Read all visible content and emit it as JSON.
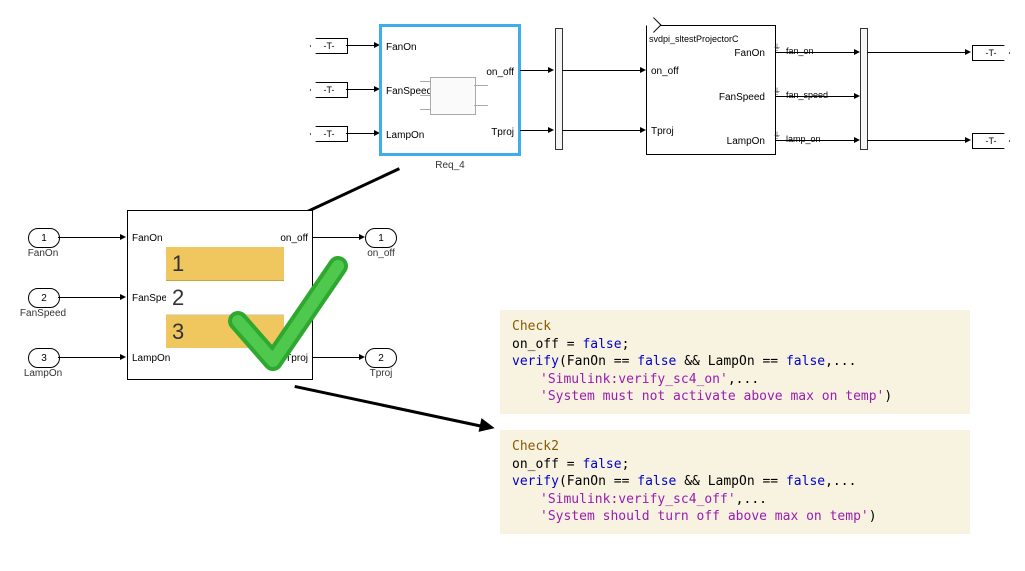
{
  "top": {
    "block1": {
      "name": "Req_4",
      "inports": [
        "FanOn",
        "FanSpeed",
        "LampOn"
      ],
      "outports": [
        "on_off",
        "Tproj"
      ]
    },
    "from_tags": [
      "-T-",
      "-T-",
      "-T-"
    ],
    "goto_tags": [
      "-T-",
      "-T-"
    ],
    "block2": {
      "name": "svdpi_sltestProjectorC",
      "inports": [
        "on_off",
        "Tproj"
      ],
      "outports": [
        "FanOn",
        "FanSpeed",
        "LampOn"
      ],
      "signals": [
        "fan_on",
        "fan_speed",
        "lamp_on"
      ]
    }
  },
  "sub": {
    "inports": [
      {
        "num": "1",
        "label": "FanOn"
      },
      {
        "num": "2",
        "label": "FanSpeed"
      },
      {
        "num": "3",
        "label": "LampOn"
      }
    ],
    "outports": [
      {
        "num": "1",
        "label": "on_off"
      },
      {
        "num": "2",
        "label": "Tproj"
      }
    ],
    "block_inports": [
      "FanOn",
      "FanSpeed",
      "LampOn"
    ],
    "block_outports": [
      "on_off",
      "Tproj"
    ],
    "steps": [
      "1",
      "2",
      "3"
    ]
  },
  "code1": {
    "title": "Check",
    "l1a": "on_off = ",
    "l1b": "false",
    "l1c": ";",
    "l2a": "verify",
    "l2b": "(FanOn == ",
    "l2c": "false",
    "l2d": " && LampOn == ",
    "l2e": "false",
    "l2f": ",...",
    "l3": "'Simulink:verify_sc4_on'",
    "l3b": ",...",
    "l4": "'System must not activate above max on temp'",
    "l4b": ")"
  },
  "code2": {
    "title": "Check2",
    "l1a": "on_off = ",
    "l1b": "false",
    "l1c": ";",
    "l2a": "verify",
    "l2b": "(FanOn == ",
    "l2c": "false",
    "l2d": " && LampOn == ",
    "l2e": "false",
    "l2f": ",...",
    "l3": "'Simulink:verify_sc4_off'",
    "l3b": ",...",
    "l4": "'System should turn off above max on temp'",
    "l4b": ")"
  }
}
